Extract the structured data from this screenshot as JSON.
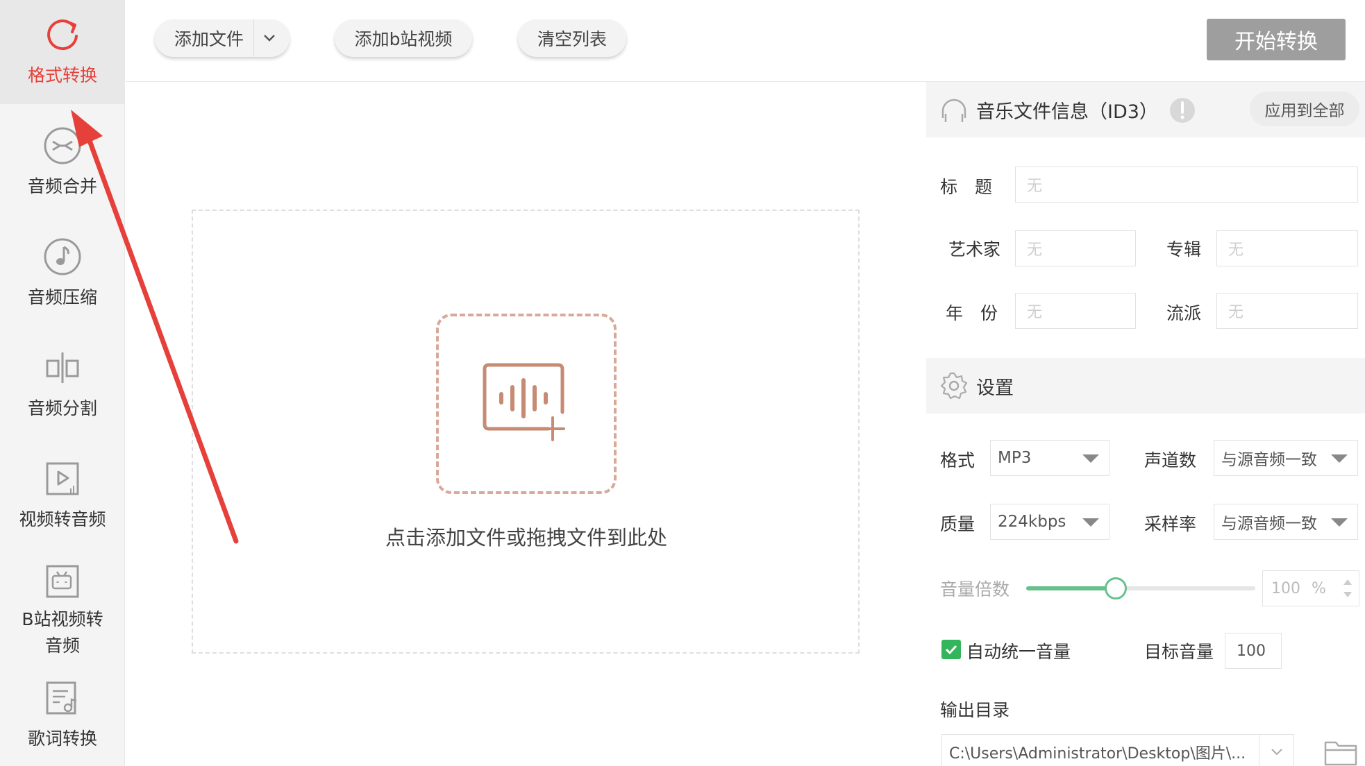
{
  "sidebar": {
    "items": [
      {
        "label": "格式转换",
        "icon": "refresh-icon",
        "active": true
      },
      {
        "label": "音频合并",
        "icon": "merge-icon"
      },
      {
        "label": "音频压缩",
        "icon": "music-note-icon"
      },
      {
        "label": "音频分割",
        "icon": "split-icon"
      },
      {
        "label": "视频转音频",
        "icon": "video-to-audio-icon"
      },
      {
        "label": "B站视频转音频",
        "label_line1": "B站视频转",
        "label_line2": "音频",
        "icon": "bilibili-tv-icon"
      },
      {
        "label": "歌词转换",
        "icon": "lyrics-icon"
      }
    ]
  },
  "toolbar": {
    "add_file_label": "添加文件",
    "add_bilibili_label": "添加b站视频",
    "clear_list_label": "清空列表",
    "start_label": "开始转换"
  },
  "dropzone": {
    "hint": "点击添加文件或拖拽文件到此处"
  },
  "id3": {
    "section_title": "音乐文件信息（ID3）",
    "apply_all_label": "应用到全部",
    "title_label": "标　题",
    "artist_label": "艺术家",
    "album_label": "专辑",
    "year_label": "年　份",
    "genre_label": "流派",
    "placeholder": "无"
  },
  "settings": {
    "section_title": "设置",
    "format_label": "格式",
    "format_value": "MP3",
    "channels_label": "声道数",
    "channels_value": "与源音频一致",
    "quality_label": "质量",
    "quality_value": "224kbps",
    "samplerate_label": "采样率",
    "samplerate_value": "与源音频一致",
    "volume_label": "音量倍数",
    "volume_value": "100",
    "volume_unit": "%",
    "volume_fraction": 0.39,
    "auto_normalize_label": "自动统一音量",
    "auto_normalize_checked": true,
    "target_volume_label": "目标音量",
    "target_volume_value": "100",
    "output_dir_label": "输出目录",
    "output_dir_value": "C:\\Users\\Administrator\\Desktop\\图片\\..."
  },
  "colors": {
    "accent_red": "#e6403a",
    "slider_green": "#68c08d",
    "check_green": "#33b55c",
    "start_button_gray": "#9e9e9e",
    "drop_border": "#d8a898"
  }
}
